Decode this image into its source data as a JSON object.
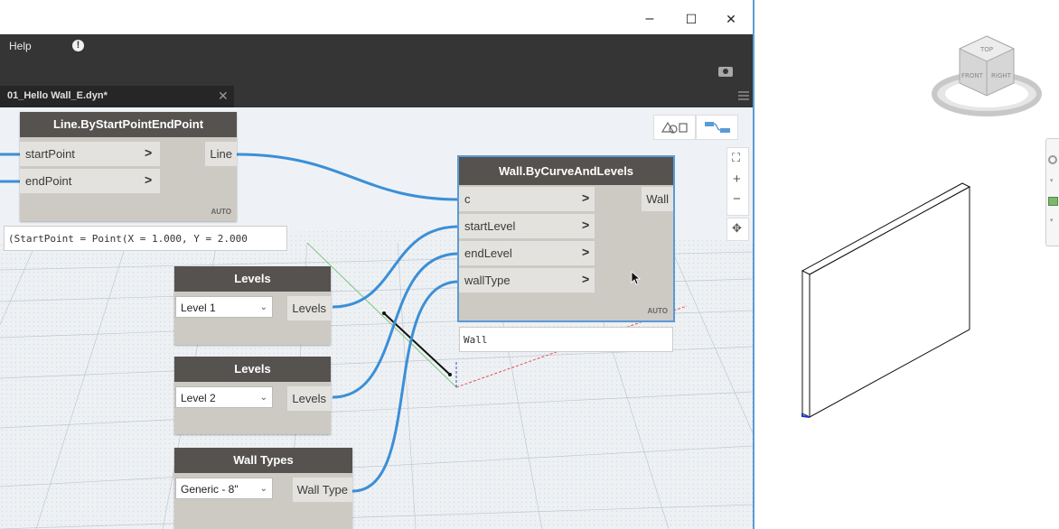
{
  "window": {
    "minimize_label": "–",
    "maximize_label": "☐",
    "close_label": "✕"
  },
  "menu": {
    "help_label": "Help",
    "alert_icon_label": "!"
  },
  "tab": {
    "label": "01_Hello Wall_E.dyn*",
    "close_label": "✕"
  },
  "nodes": {
    "line": {
      "title": "Line.ByStartPointEndPoint",
      "inputs": [
        "startPoint",
        "endPoint"
      ],
      "output": "Line",
      "lacing": "AUTO",
      "preview": "(StartPoint = Point(X = 1.000, Y = 2.000"
    },
    "wall": {
      "title": "Wall.ByCurveAndLevels",
      "inputs": [
        "c",
        "startLevel",
        "endLevel",
        "wallType"
      ],
      "output": "Wall",
      "lacing": "AUTO",
      "preview": "Wall"
    },
    "levels1": {
      "title": "Levels",
      "selected": "Level 1",
      "output": "Levels"
    },
    "levels2": {
      "title": "Levels",
      "selected": "Level 2",
      "output": "Levels"
    },
    "walltypes": {
      "title": "Wall Types",
      "selected": "Generic - 8\"",
      "output": "Wall Type"
    }
  },
  "view_controls": {
    "zoom_in_label": "+",
    "zoom_out_label": "−",
    "fit_label": "⛶",
    "pan_label": "✥"
  },
  "navcube": {
    "top_label": "TOP",
    "front_label": "FRONT",
    "right_label": "RIGHT"
  },
  "colors": {
    "wire": "#3c8fd6",
    "node_title": "#555250",
    "node_body": "#cdcac4",
    "selected": "#5b9bd5",
    "dark_chrome": "#353535"
  }
}
